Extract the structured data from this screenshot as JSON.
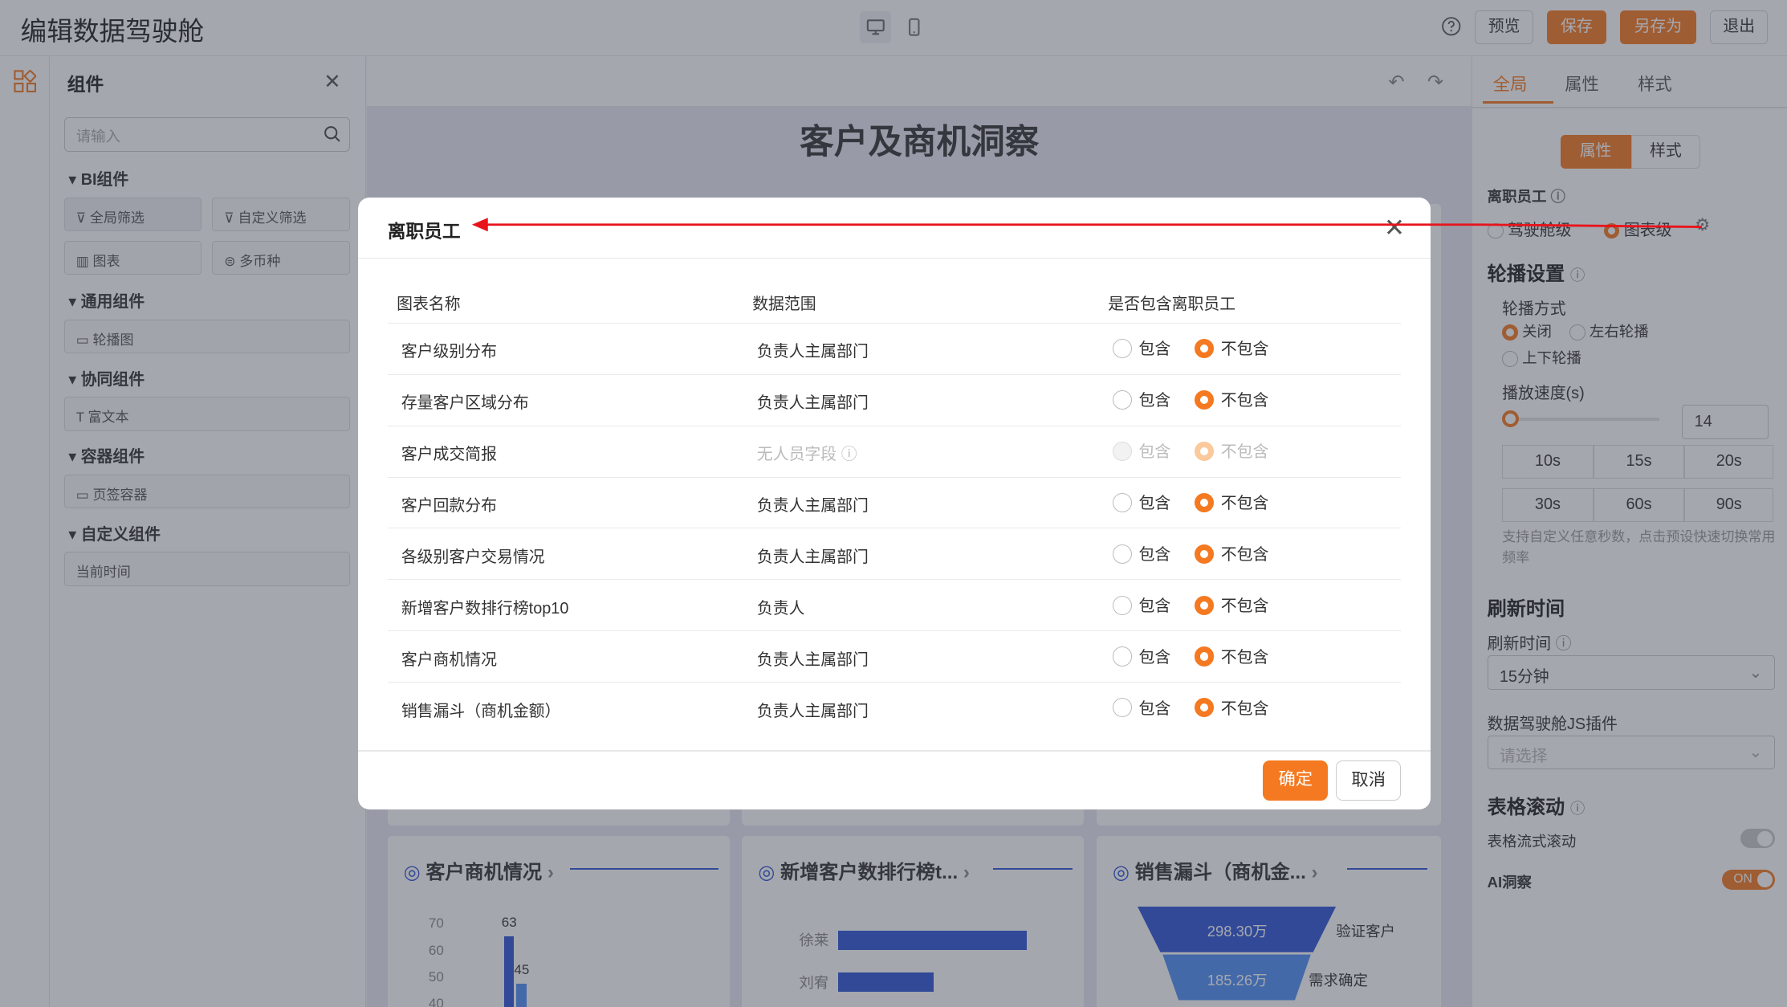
{
  "header": {
    "title": "编辑数据驾驶舱",
    "preview": "预览",
    "save": "保存",
    "save_as": "另存为",
    "exit": "退出"
  },
  "left_panel": {
    "title": "组件",
    "search_placeholder": "请输入",
    "sections": [
      {
        "label": "BI组件",
        "items": [
          "全局筛选",
          "自定义筛选",
          "图表",
          "多币种"
        ]
      },
      {
        "label": "通用组件",
        "items": [
          "轮播图"
        ]
      },
      {
        "label": "协同组件",
        "items": [
          "富文本"
        ]
      },
      {
        "label": "容器组件",
        "items": [
          "页签容器"
        ]
      },
      {
        "label": "自定义组件",
        "items": [
          "当前时间"
        ]
      }
    ]
  },
  "canvas": {
    "title": "客户及商机洞察",
    "cards": [
      {
        "title": "客户商机情况"
      },
      {
        "title": "新增客户数排行榜t..."
      },
      {
        "title": "销售漏斗（商机金..."
      }
    ],
    "bar_chart": {
      "y_ticks": [
        "70",
        "60",
        "50",
        "40"
      ],
      "labels": [
        "63",
        "45"
      ]
    },
    "rank_chart": {
      "names": [
        "徐莱",
        "刘宥"
      ]
    },
    "funnel": {
      "values": [
        "298.30万",
        "185.26万"
      ],
      "stages": [
        "验证客户",
        "需求确定"
      ]
    }
  },
  "right_panel": {
    "tabs": [
      "全局",
      "属性",
      "样式"
    ],
    "sub_tabs": [
      "属性",
      "样式"
    ],
    "departed_label": "离职员工",
    "departed_options": [
      "驾驶舱级",
      "图表级"
    ],
    "carousel_title": "轮播设置",
    "carousel_mode_label": "轮播方式",
    "carousel_modes": [
      "关闭",
      "左右轮播",
      "上下轮播"
    ],
    "speed_label": "播放速度(s)",
    "speed_value": "14",
    "speed_presets": [
      "10s",
      "15s",
      "20s",
      "30s",
      "60s",
      "90s"
    ],
    "speed_hint": "支持自定义任意秒数，点击预设快速切换常用频率",
    "refresh_title": "刷新时间",
    "refresh_label": "刷新时间",
    "refresh_value": "15分钟",
    "plugin_label": "数据驾驶舱JS插件",
    "plugin_placeholder": "请选择",
    "table_scroll_title": "表格滚动",
    "table_scroll_label": "表格流式滚动",
    "ai_label": "AI洞察",
    "ai_toggle": "ON"
  },
  "modal": {
    "title": "离职员工",
    "columns": [
      "图表名称",
      "数据范围",
      "是否包含离职员工"
    ],
    "rows": [
      {
        "name": "客户级别分布",
        "scope": "负责人主属部门",
        "include": "包含",
        "exclude": "不包含"
      },
      {
        "name": "存量客户区域分布",
        "scope": "负责人主属部门",
        "include": "包含",
        "exclude": "不包含"
      },
      {
        "name": "客户成交简报",
        "scope": "无人员字段",
        "include": "包含",
        "exclude": "不包含"
      },
      {
        "name": "客户回款分布",
        "scope": "负责人主属部门",
        "include": "包含",
        "exclude": "不包含"
      },
      {
        "name": "各级别客户交易情况",
        "scope": "负责人主属部门",
        "include": "包含",
        "exclude": "不包含"
      },
      {
        "name": "新增客户数排行榜top10",
        "scope": "负责人",
        "include": "包含",
        "exclude": "不包含"
      },
      {
        "name": "客户商机情况",
        "scope": "负责人主属部门",
        "include": "包含",
        "exclude": "不包含"
      },
      {
        "name": "销售漏斗（商机金额）",
        "scope": "负责人主属部门",
        "include": "包含",
        "exclude": "不包含"
      }
    ],
    "confirm": "确定",
    "cancel": "取消"
  },
  "colors": {
    "accent": "#f47920",
    "annotation": "#e8141c",
    "chart_blue": "#2c54d6"
  }
}
